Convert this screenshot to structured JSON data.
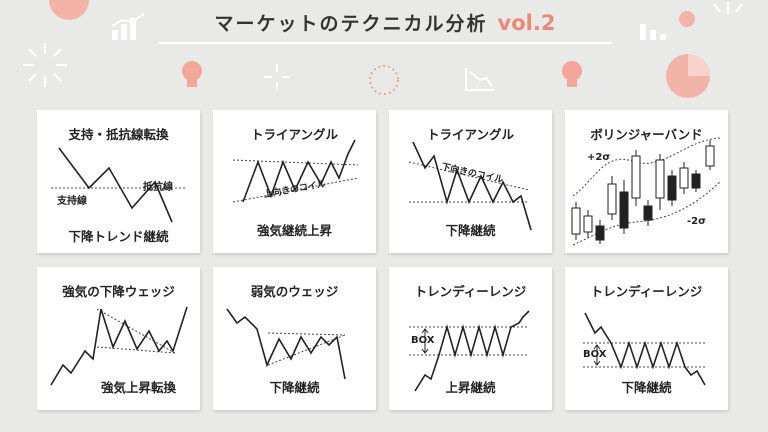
{
  "header": {
    "title": "マーケットのテクニカル分析",
    "volume": "vol.2"
  },
  "colors": {
    "background": "#e9e9e7",
    "accent": "#ec8878",
    "card": "#ffffff",
    "line": "#222222"
  },
  "decorations": [
    "bar-chart-icon",
    "pie-chart-icon",
    "lightbulb-icon",
    "sparkle-icon",
    "line-chart-icon"
  ],
  "cards": [
    {
      "title": "支持・抵抗線転換",
      "subtitle": "下降トレンド継続",
      "labels": [
        "支持線",
        "抵抗線"
      ]
    },
    {
      "title": "トライアングル",
      "subtitle": "強気継続上昇",
      "labels": [
        "上向きのコイル"
      ]
    },
    {
      "title": "トライアングル",
      "subtitle": "下降継続",
      "labels": [
        "下向きのコイル"
      ]
    },
    {
      "title": "ボリンジャーバンド",
      "subtitle": "",
      "labels": [
        "+2σ",
        "-2σ"
      ]
    },
    {
      "title": "強気の下降ウェッジ",
      "subtitle": "強気上昇転換",
      "labels": []
    },
    {
      "title": "弱気のウェッジ",
      "subtitle": "下降継続",
      "labels": []
    },
    {
      "title": "トレンディーレンジ",
      "subtitle": "上昇継続",
      "labels": [
        "BOX"
      ]
    },
    {
      "title": "トレンディーレンジ",
      "subtitle": "下降継続",
      "labels": [
        "BOX"
      ]
    }
  ]
}
